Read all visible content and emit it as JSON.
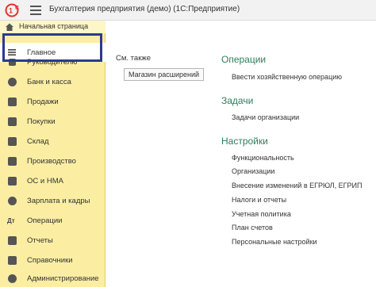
{
  "window": {
    "title": "Бухгалтерия предприятия (демо)  (1С:Предприятие)"
  },
  "sidebar": {
    "home_label": "Начальная страница",
    "items": [
      {
        "label": "Главное",
        "icon": "menu-lines-icon"
      },
      {
        "label": "Руководителю",
        "icon": "chart-icon"
      },
      {
        "label": "Банк и касса",
        "icon": "coins-icon"
      },
      {
        "label": "Продажи",
        "icon": "bag-icon"
      },
      {
        "label": "Покупки",
        "icon": "cart-icon"
      },
      {
        "label": "Склад",
        "icon": "warehouse-icon"
      },
      {
        "label": "Производство",
        "icon": "factory-icon"
      },
      {
        "label": "ОС и НМА",
        "icon": "assets-icon"
      },
      {
        "label": "Зарплата и кадры",
        "icon": "people-icon"
      },
      {
        "label": "Операции",
        "icon": "operations-icon"
      },
      {
        "label": "Отчеты",
        "icon": "report-icon"
      },
      {
        "label": "Справочники",
        "icon": "book-icon"
      },
      {
        "label": "Администрирование",
        "icon": "gear-icon"
      }
    ]
  },
  "main": {
    "see_also_label": "См. также",
    "extensions_button": "Магазин расширений",
    "sections": [
      {
        "title": "Операции",
        "links": [
          "Ввести хозяйственную операцию"
        ]
      },
      {
        "title": "Задачи",
        "links": [
          "Задачи организации"
        ]
      },
      {
        "title": "Настройки",
        "links": [
          "Функциональность",
          "Организации",
          "Внесение изменений в ЕГРЮЛ, ЕГРИП",
          "Налоги и отчеты",
          "Учетная политика",
          "План счетов",
          "Персональные настройки"
        ]
      }
    ]
  },
  "colors": {
    "sidebar_bg": "#fbeea3",
    "section_title": "#2e7d5b",
    "highlight": "#2b3a8f",
    "logo": "#e4322b"
  }
}
